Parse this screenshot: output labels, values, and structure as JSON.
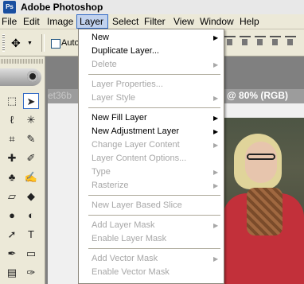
{
  "app": {
    "title": "Adobe Photoshop",
    "logo_text": "Ps"
  },
  "menubar": [
    {
      "label": "File"
    },
    {
      "label": "Edit"
    },
    {
      "label": "Image"
    },
    {
      "label": "Layer",
      "active": true
    },
    {
      "label": "Select"
    },
    {
      "label": "Filter"
    },
    {
      "label": "View"
    },
    {
      "label": "Window"
    },
    {
      "label": "Help"
    }
  ],
  "options_bar": {
    "auto_select_label": "Auto",
    "auto_select_checked": false
  },
  "document": {
    "name_fragment": "et36b",
    "zoom_label": "@ 80% (RGB)"
  },
  "layer_menu": {
    "items": [
      {
        "label": "New",
        "enabled": true,
        "submenu": true
      },
      {
        "label": "Duplicate Layer...",
        "enabled": true,
        "submenu": false
      },
      {
        "label": "Delete",
        "enabled": false,
        "submenu": true
      },
      {
        "separator": true
      },
      {
        "label": "Layer Properties...",
        "enabled": false,
        "submenu": false
      },
      {
        "label": "Layer Style",
        "enabled": false,
        "submenu": true
      },
      {
        "separator": true
      },
      {
        "label": "New Fill Layer",
        "enabled": true,
        "submenu": true
      },
      {
        "label": "New Adjustment Layer",
        "enabled": true,
        "submenu": true
      },
      {
        "label": "Change Layer Content",
        "enabled": false,
        "submenu": true
      },
      {
        "label": "Layer Content Options...",
        "enabled": false,
        "submenu": false
      },
      {
        "label": "Type",
        "enabled": false,
        "submenu": true
      },
      {
        "label": "Rasterize",
        "enabled": false,
        "submenu": true
      },
      {
        "separator": true
      },
      {
        "label": "New Layer Based Slice",
        "enabled": false,
        "submenu": false
      },
      {
        "separator": true
      },
      {
        "label": "Add Layer Mask",
        "enabled": false,
        "submenu": true
      },
      {
        "label": "Enable Layer Mask",
        "enabled": false,
        "submenu": false
      },
      {
        "separator": true
      },
      {
        "label": "Add Vector Mask",
        "enabled": false,
        "submenu": true
      },
      {
        "label": "Enable Vector Mask",
        "enabled": false,
        "submenu": false
      }
    ]
  },
  "toolbox": {
    "tools": [
      {
        "name": "marquee-tool-icon",
        "glyph": "⬚"
      },
      {
        "name": "move-tool-icon",
        "glyph": "➤",
        "selected": true
      },
      {
        "name": "lasso-tool-icon",
        "glyph": "ℓ"
      },
      {
        "name": "magic-wand-icon",
        "glyph": "✳"
      },
      {
        "name": "crop-tool-icon",
        "glyph": "⌗"
      },
      {
        "name": "slice-tool-icon",
        "glyph": "✎"
      },
      {
        "name": "healing-brush-icon",
        "glyph": "✚"
      },
      {
        "name": "brush-tool-icon",
        "glyph": "✐"
      },
      {
        "name": "clone-stamp-icon",
        "glyph": "♣"
      },
      {
        "name": "history-brush-icon",
        "glyph": "✍"
      },
      {
        "name": "eraser-tool-icon",
        "glyph": "▱"
      },
      {
        "name": "paint-bucket-icon",
        "glyph": "◆"
      },
      {
        "name": "blur-tool-icon",
        "glyph": "●"
      },
      {
        "name": "dodge-tool-icon",
        "glyph": "◐"
      },
      {
        "name": "path-select-icon",
        "glyph": "➚"
      },
      {
        "name": "type-tool-icon",
        "glyph": "T"
      },
      {
        "name": "pen-tool-icon",
        "glyph": "✒"
      },
      {
        "name": "shape-tool-icon",
        "glyph": "▭"
      },
      {
        "name": "notes-tool-icon",
        "glyph": "▤"
      },
      {
        "name": "eyedropper-icon",
        "glyph": "✑"
      }
    ]
  },
  "colors": {
    "menu_highlight": "#c1d2ee",
    "menu_border": "#316ac5",
    "disabled_text": "#a7a7a7"
  }
}
